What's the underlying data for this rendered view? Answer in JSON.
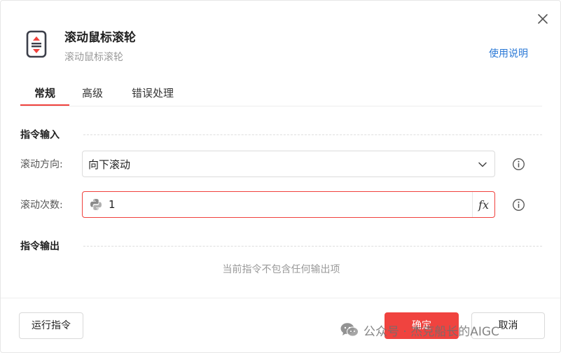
{
  "header": {
    "title": "滚动鼠标滚轮",
    "subtitle": "滚动鼠标滚轮",
    "help_link": "使用说明",
    "icon": "scroll-wheel-icon"
  },
  "tabs": [
    {
      "label": "常规",
      "active": true
    },
    {
      "label": "高级",
      "active": false
    },
    {
      "label": "错误处理",
      "active": false
    }
  ],
  "input_section": {
    "title": "指令输入",
    "fields": [
      {
        "label": "滚动方向:",
        "type": "select",
        "value": "向下滚动",
        "icon": "chevron-down-icon"
      },
      {
        "label": "滚动次数:",
        "type": "expression",
        "value": "1",
        "prefix_icon": "python-icon",
        "suffix_button": "fx"
      }
    ]
  },
  "output_section": {
    "title": "指令输出",
    "empty_text": "当前指令不包含任何输出项"
  },
  "footer": {
    "run_label": "运行指令",
    "ok_label": "确定",
    "cancel_label": "取消"
  },
  "watermark": {
    "text": "公众号 · 杰克船长的AIGC",
    "icon": "wechat-icon"
  },
  "colors": {
    "accent": "#f0413d",
    "link": "#2a78d6",
    "muted_text": "#9a9a9a"
  }
}
